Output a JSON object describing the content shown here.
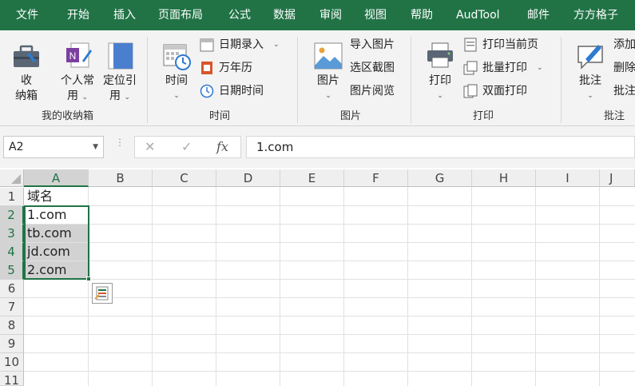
{
  "tabs": [
    "文件",
    "开始",
    "插入",
    "页面布局",
    "公式",
    "数据",
    "审阅",
    "视图",
    "帮助",
    "AudTool",
    "邮件",
    "方方格子"
  ],
  "ribbon": {
    "groups": {
      "storage": {
        "label": "我的收纳箱",
        "btn1": [
          "收",
          "纳箱"
        ],
        "btn2": [
          "个人常",
          "用"
        ],
        "btn3": [
          "定位引",
          "用"
        ]
      },
      "time": {
        "label": "时间",
        "big": "时间",
        "items": [
          "日期录入",
          "万年历",
          "日期时间"
        ]
      },
      "picture": {
        "label": "图片",
        "big": "图片",
        "items": [
          "导入图片",
          "选区截图",
          "图片阅览"
        ]
      },
      "print": {
        "label": "打印",
        "big": "打印",
        "items": [
          "打印当前页",
          "批量打印",
          "双面打印"
        ]
      },
      "annotate": {
        "label": "批注",
        "big": "批注",
        "items": [
          "添加",
          "删除",
          "批注"
        ]
      }
    }
  },
  "formula_bar": {
    "name_box": "A2",
    "cancel": "✕",
    "enter": "✓",
    "fx": "fx",
    "content": "1.com"
  },
  "sheet": {
    "columns": [
      "A",
      "B",
      "C",
      "D",
      "E",
      "F",
      "G",
      "H",
      "I",
      "J"
    ],
    "rows": [
      "1",
      "2",
      "3",
      "4",
      "5",
      "6",
      "7",
      "8",
      "9",
      "10",
      "11"
    ],
    "cells": [
      "域名",
      "1.com",
      "tb.com",
      "jd.com",
      "2.com"
    ]
  }
}
